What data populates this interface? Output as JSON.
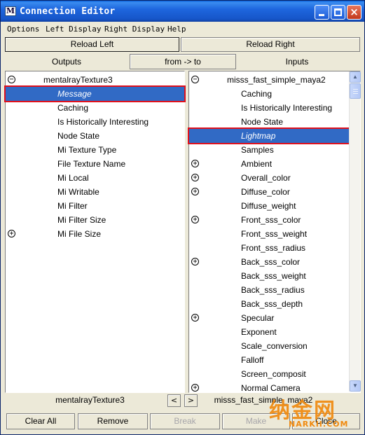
{
  "window": {
    "title": "Connection Editor",
    "icon": "maya-icon",
    "controls": {
      "minimize": "minimize-icon",
      "maximize": "maximize-icon",
      "close": "×"
    }
  },
  "menu": [
    "Options",
    "Left Display",
    "Right Display",
    "Help"
  ],
  "toolbar": {
    "reload_left": "Reload Left",
    "reload_right": "Reload Right",
    "outputs": "Outputs",
    "from_to": "from -> to",
    "inputs": "Inputs"
  },
  "left_pane": {
    "node": "mentalrayTexture3",
    "items": [
      {
        "label": "Message",
        "selected": true
      },
      {
        "label": "Caching"
      },
      {
        "label": "Is Historically Interesting"
      },
      {
        "label": "Node State"
      },
      {
        "label": "Mi Texture Type"
      },
      {
        "label": "File Texture Name"
      },
      {
        "label": "Mi Local"
      },
      {
        "label": "Mi Writable"
      },
      {
        "label": "Mi Filter"
      },
      {
        "label": "Mi Filter Size"
      },
      {
        "label": "Mi File Size",
        "expandable": true
      }
    ]
  },
  "right_pane": {
    "node": "misss_fast_simple_maya2",
    "items": [
      {
        "label": "Caching"
      },
      {
        "label": "Is Historically Interesting"
      },
      {
        "label": "Node State"
      },
      {
        "label": "Lightmap",
        "selected": true
      },
      {
        "label": "Samples"
      },
      {
        "label": "Ambient",
        "expandable": true
      },
      {
        "label": "Overall_color",
        "expandable": true
      },
      {
        "label": "Diffuse_color",
        "expandable": true
      },
      {
        "label": "Diffuse_weight"
      },
      {
        "label": "Front_sss_color",
        "expandable": true
      },
      {
        "label": "Front_sss_weight"
      },
      {
        "label": "Front_sss_radius"
      },
      {
        "label": "Back_sss_color",
        "expandable": true
      },
      {
        "label": "Back_sss_weight"
      },
      {
        "label": "Back_sss_radius"
      },
      {
        "label": "Back_sss_depth"
      },
      {
        "label": "Specular",
        "expandable": true
      },
      {
        "label": "Exponent"
      },
      {
        "label": "Scale_conversion"
      },
      {
        "label": "Falloff"
      },
      {
        "label": "Screen_composit"
      },
      {
        "label": "Normal Camera",
        "expandable": true
      }
    ]
  },
  "footer": {
    "left_node": "mentalrayTexture3",
    "right_node": "misss_fast_simple_maya2",
    "arrow_left": "<",
    "arrow_right": ">",
    "buttons": {
      "clear_all": "Clear All",
      "remove": "Remove",
      "break": "Break",
      "make": "Make",
      "close": "Close"
    }
  },
  "watermark": {
    "main": "纳金网",
    "sub": "NARKII.COM"
  },
  "colors": {
    "selection": "#316ac5",
    "highlight_box": "#e0101c",
    "titlebar": "#1e66de",
    "watermark": "#f08a10"
  }
}
